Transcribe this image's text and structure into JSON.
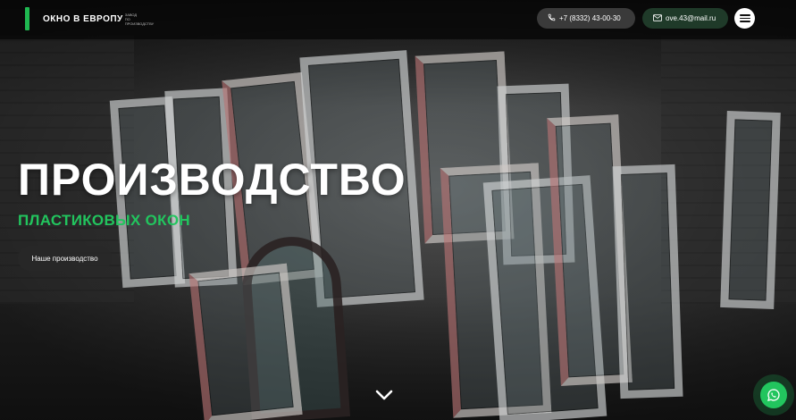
{
  "header": {
    "logo_text": "ОКНО В ЕВРОПУ",
    "logo_subtext": "ЗАВОД ПО ПРОИЗВОДСТВУ",
    "phone": "+7 (8332) 43-00-30",
    "email": "ove.43@mail.ru"
  },
  "hero": {
    "title": "ПРОИЗВОДСТВО",
    "subtitle": "ПЛАСТИКОВЫХ ОКОН",
    "cta_label": "Наше производство"
  },
  "colors": {
    "accent": "#22c55e",
    "mail_pill": "#1f3a29",
    "phone_pill": "#3a3a3a"
  },
  "icons": [
    "phone-icon",
    "mail-icon",
    "menu-icon",
    "chevron-down-icon",
    "whatsapp-icon"
  ]
}
